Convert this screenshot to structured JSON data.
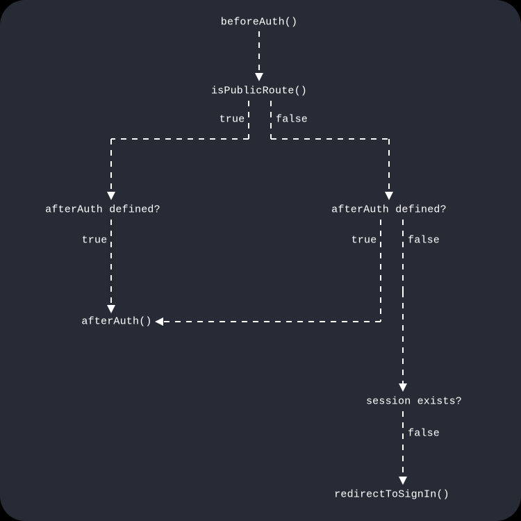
{
  "diagram": {
    "nodes": {
      "beforeAuth": "beforeAuth()",
      "isPublicRoute": "isPublicRoute()",
      "afterAuthDefinedLeft": "afterAuth defined?",
      "afterAuthDefinedRight": "afterAuth defined?",
      "afterAuth": "afterAuth()",
      "sessionExists": "session exists?",
      "redirectToSignIn": "redirectToSignIn()"
    },
    "labels": {
      "isPublicTrue": "true",
      "isPublicFalse": "false",
      "leftDefinedTrue": "true",
      "rightDefinedTrue": "true",
      "rightDefinedFalse": "false",
      "sessionFalse": "false"
    }
  }
}
